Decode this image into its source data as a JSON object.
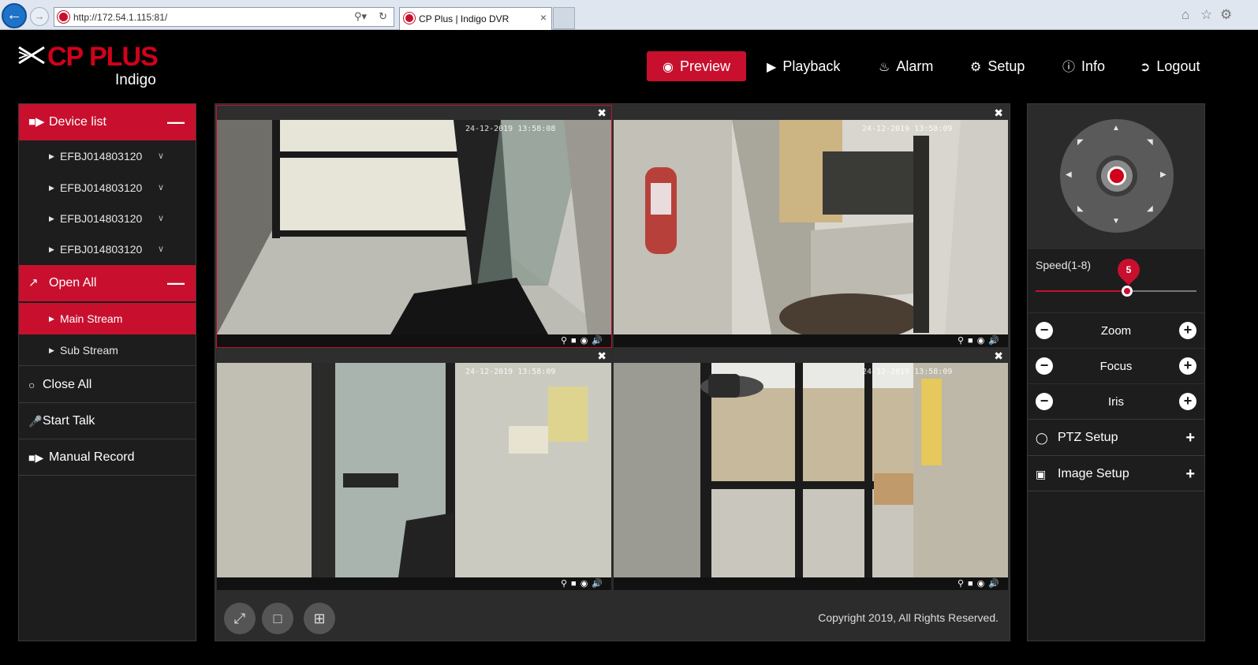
{
  "browser": {
    "url": "http://172.54.1.115:81/",
    "tab_title": "CP Plus | Indigo DVR",
    "tab_close": "×"
  },
  "brand": {
    "name": "CP PLUS",
    "sub": "Indigo"
  },
  "nav": [
    {
      "label": "Preview",
      "icon": "eye-icon"
    },
    {
      "label": "Playback",
      "icon": "play-circle-icon"
    },
    {
      "label": "Alarm",
      "icon": "bell-icon"
    },
    {
      "label": "Setup",
      "icon": "gear-icon"
    },
    {
      "label": "Info",
      "icon": "info-icon"
    },
    {
      "label": "Logout",
      "icon": "logout-icon"
    }
  ],
  "sidebar": {
    "device_list": "Device list",
    "devices": [
      "EFBJ014803120",
      "EFBJ014803120",
      "EFBJ014803120",
      "EFBJ014803120"
    ],
    "open_all": "Open All",
    "streams": [
      "Main Stream",
      "Sub Stream"
    ],
    "close_all": "Close All",
    "start_talk": "Start Talk",
    "manual_record": "Manual Record"
  },
  "cameras": [
    {
      "timestamp": "24-12-2019 13:58:08"
    },
    {
      "timestamp": "24-12-2019 13:58:09"
    },
    {
      "timestamp": "24-12-2019 13:58:09"
    },
    {
      "timestamp": "24-12-2019 13:58:09"
    }
  ],
  "footer": {
    "copyright": "Copyright 2019, All Rights Reserved."
  },
  "ptz": {
    "speed_label": "Speed(1-8)",
    "speed_value": "5",
    "speed_fraction": 0.57,
    "controls": [
      "Zoom",
      "Focus",
      "Iris"
    ],
    "ptz_setup": "PTZ Setup",
    "image_setup": "Image Setup"
  },
  "colors": {
    "accent": "#c8102e",
    "panel": "#1d1d1d",
    "background": "#000000"
  }
}
